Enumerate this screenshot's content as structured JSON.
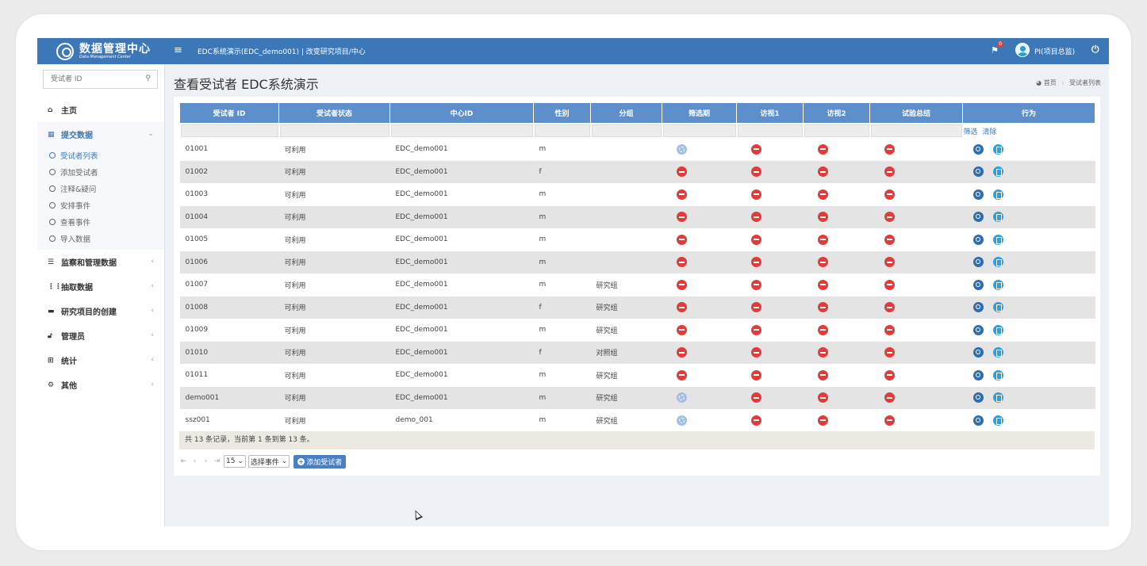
{
  "header": {
    "logo_cn": "数据管理中心",
    "logo_en": "Data Management Center",
    "menu_icon": "≡",
    "project_title": "EDC系统演示(EDC_demo001)  |  改变研究项目/中心",
    "notification_count": "0",
    "user_name": "PI(项目总监)"
  },
  "sidebar": {
    "search_placeholder": "受试者 ID",
    "items": [
      {
        "label": "主页",
        "icon": "home-icon"
      },
      {
        "label": "提交数据",
        "icon": "grid-icon"
      },
      {
        "label": "监察和管理数据",
        "icon": "list-icon"
      },
      {
        "label": "抽取数据",
        "icon": "th-icon"
      },
      {
        "label": "研究项目的创建",
        "icon": "folder-icon"
      },
      {
        "label": "管理员",
        "icon": "lock-icon"
      },
      {
        "label": "统计",
        "icon": "table-icon"
      },
      {
        "label": "其他",
        "icon": "gear-icon"
      }
    ],
    "sub_items": [
      "受试者列表",
      "添加受试者",
      "注释&疑问",
      "安排事件",
      "查看事件",
      "导入数据"
    ]
  },
  "page": {
    "title": "查看受试者 EDC系统演示",
    "breadcrumb_home": "首页",
    "breadcrumb_current": "受试者列表"
  },
  "table": {
    "columns": [
      "受试者 ID",
      "受试者状态",
      "中心ID",
      "性别",
      "分组",
      "筛选期",
      "访视1",
      "访视2",
      "试验总结",
      "行为"
    ],
    "filter_link": "筛选",
    "clear_link": "清除",
    "rows": [
      {
        "id": "01001",
        "status": "可利用",
        "site": "EDC_demo001",
        "sex": "m",
        "group": "",
        "screen": "scheduled"
      },
      {
        "id": "01002",
        "status": "可利用",
        "site": "EDC_demo001",
        "sex": "f",
        "group": "",
        "screen": "not-started"
      },
      {
        "id": "01003",
        "status": "可利用",
        "site": "EDC_demo001",
        "sex": "m",
        "group": "",
        "screen": "not-started"
      },
      {
        "id": "01004",
        "status": "可利用",
        "site": "EDC_demo001",
        "sex": "m",
        "group": "",
        "screen": "not-started"
      },
      {
        "id": "01005",
        "status": "可利用",
        "site": "EDC_demo001",
        "sex": "m",
        "group": "",
        "screen": "not-started"
      },
      {
        "id": "01006",
        "status": "可利用",
        "site": "EDC_demo001",
        "sex": "m",
        "group": "",
        "screen": "not-started"
      },
      {
        "id": "01007",
        "status": "可利用",
        "site": "EDC_demo001",
        "sex": "m",
        "group": "研究组",
        "screen": "not-started"
      },
      {
        "id": "01008",
        "status": "可利用",
        "site": "EDC_demo001",
        "sex": "f",
        "group": "研究组",
        "screen": "not-started"
      },
      {
        "id": "01009",
        "status": "可利用",
        "site": "EDC_demo001",
        "sex": "m",
        "group": "研究组",
        "screen": "not-started"
      },
      {
        "id": "01010",
        "status": "可利用",
        "site": "EDC_demo001",
        "sex": "f",
        "group": "对照组",
        "screen": "not-started"
      },
      {
        "id": "01011",
        "status": "可利用",
        "site": "EDC_demo001",
        "sex": "m",
        "group": "研究组",
        "screen": "not-started"
      },
      {
        "id": "demo001",
        "status": "可利用",
        "site": "EDC_demo001",
        "sex": "m",
        "group": "研究组",
        "screen": "scheduled"
      },
      {
        "id": "ssz001",
        "status": "可利用",
        "site": "demo_001",
        "sex": "m",
        "group": "研究组",
        "screen": "scheduled"
      }
    ]
  },
  "summary": "共 13 条记录，当前第 1 条到第 13 条。",
  "pager": {
    "page_size": "15",
    "event_select": "选择事件",
    "add_button": "添加受试者"
  },
  "colors": {
    "topbar": "#3c78b8",
    "header_cell": "#5c8fcc",
    "status_red": "#e03c3c",
    "status_scheduled": "#a3bfe3"
  }
}
